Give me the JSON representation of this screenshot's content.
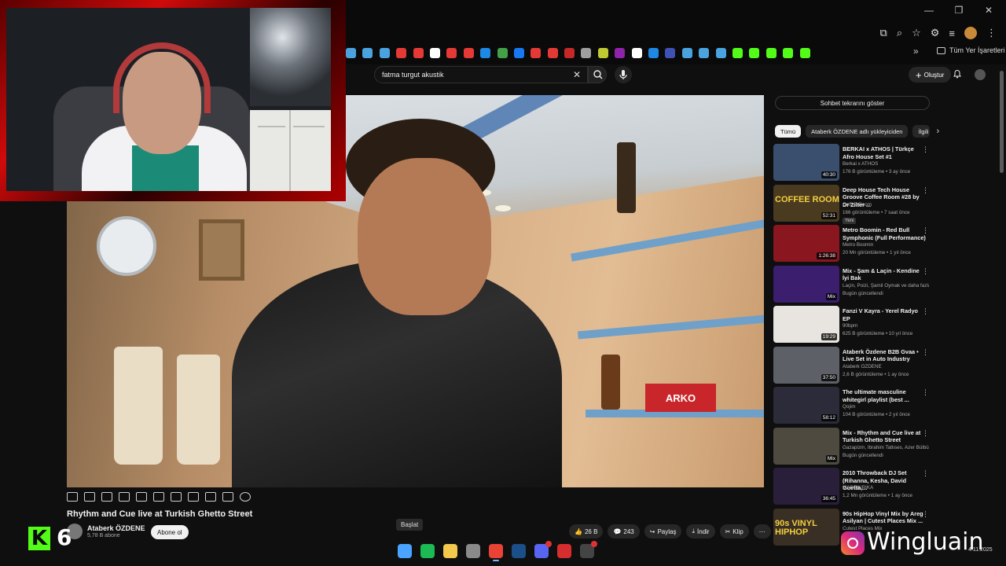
{
  "browser": {
    "bookmarks_folder": "Tüm Yer İşaretleri",
    "bookmark_colors": [
      "#4aa3df",
      "#4aa3df",
      "#4aa3df",
      "#e53935",
      "#e53935",
      "#ffffff",
      "#e53935",
      "#e53935",
      "#1e88e5",
      "#43a047",
      "#1877f2",
      "#e53935",
      "#e53935",
      "#c62828",
      "#9e9e9e",
      "#c0ca33",
      "#8e24aa",
      "#ffffff",
      "#1e88e5",
      "#3f51b5",
      "#4aa3df",
      "#4aa3df",
      "#4aa3df",
      "#53fc18",
      "#53fc18",
      "#53fc18",
      "#53fc18",
      "#53fc18"
    ]
  },
  "youtube": {
    "search": {
      "value": "fatma turgut akustik"
    },
    "create_label": "Oluştur"
  },
  "video": {
    "title": "Rhythm and Cue live at Turkish Ghetto Street",
    "scene_sign": "ARKO",
    "channel": {
      "name": "Ataberk ÖZDENE",
      "subs": "5,78 B abone"
    },
    "subscribe_label": "Abone ol",
    "actions": {
      "likes": "26 B",
      "dislikes": "243",
      "share": "Paylaş",
      "download": "İndir",
      "clip": "Klip"
    }
  },
  "tooltip": "Başlat",
  "sidebar": {
    "chat_label": "Sohbet tekrarını göster",
    "chips": [
      "Tümü",
      "Ataberk ÖZDENE adlı yükleyiciden",
      "İlgili"
    ],
    "recs": [
      {
        "title": "BERKAI x ATHOS | Türkçe Afro House Set #1",
        "channel": "Berkai x ATHOS",
        "meta": "176 B görüntüleme • 3 ay önce",
        "duration": "40:30",
        "color": "#3a4f6e",
        "badge": ""
      },
      {
        "title": "Deep House Tech House Groove Coffee Room #28 by Dr Zilter ...",
        "channel": "Coffee Room",
        "meta": "166 görüntüleme • 7 saat önce",
        "duration": "52:31",
        "color": "#4a3a20",
        "badge": "Yeni",
        "thumb_text": "COFFEE ROOM"
      },
      {
        "title": "Metro Boomin - Red Bull Symphonic (Full Performance)",
        "channel": "Metro Boomin",
        "meta": "20 Mn görüntüleme • 1 yıl önce",
        "duration": "1:26:38",
        "color": "#8a1620",
        "badge": ""
      },
      {
        "title": "Mix - Şam & Laçin - Kendine İyi Bak",
        "channel": "Laçin, Poizi, Şamil Oymak ve daha fazlası",
        "meta": "Bugün güncellendi",
        "duration": "Mix",
        "color": "#3b1e6e",
        "badge": ""
      },
      {
        "title": "Fanzi V Kayra - Yerel Radyo EP",
        "channel": "90bpm",
        "meta": "625 B görüntüleme • 10 yıl önce",
        "duration": "19:29",
        "color": "#e8e4e0",
        "badge": ""
      },
      {
        "title": "Ataberk Özdene B2B Gvaa • Live Set in Auto Industry",
        "channel": "Ataberk ÖZDENE",
        "meta": "2,6 B görüntüleme • 1 ay önce",
        "duration": "37:50",
        "color": "#5d6066",
        "badge": ""
      },
      {
        "title": "The ultimate masculine whitegirl playlist (best ...",
        "channel": "Qojim",
        "meta": "104 B görüntüleme • 2 yıl önce",
        "duration": "58:12",
        "color": "#2b2b3a",
        "badge": ""
      },
      {
        "title": "Mix - Rhythm and Cue live at Turkish Ghetto Street",
        "channel": "Gazapizm, İbrahim Tatlıses, Azer Bülbül v...",
        "meta": "Bugün güncellendi",
        "duration": "Mix",
        "color": "#4e4a40",
        "badge": ""
      },
      {
        "title": "2010 Throwback DJ Set (Rihanna, Kesha, David Guetta,...",
        "channel": "MADEINRIKA",
        "meta": "1,2 Mn görüntüleme • 1 ay önce",
        "duration": "36:45",
        "color": "#2a1f3a",
        "badge": ""
      },
      {
        "title": "90s HipHop Vinyl Mix by Areg Asilyan | Cutest Places Mix ...",
        "channel": "Cutest Places Mix",
        "meta": "",
        "duration": "",
        "color": "#3a2f24",
        "badge": "",
        "thumb_text": "90s VINYL HIPHOP"
      }
    ]
  },
  "overlay": {
    "kick_count": "6",
    "kick_letter": "K",
    "instagram": "Wingluain"
  },
  "system": {
    "date": "4.11.2025"
  },
  "taskbar": [
    {
      "name": "windows-start-icon",
      "color": "#4aa3ff"
    },
    {
      "name": "spotify-icon",
      "color": "#1db954"
    },
    {
      "name": "file-explorer-icon",
      "color": "#f2c94c"
    },
    {
      "name": "settings-icon",
      "color": "#8a8a8a"
    },
    {
      "name": "chrome-icon",
      "color": "#ea4335",
      "active": true
    },
    {
      "name": "steam-icon",
      "color": "#1b4f8a"
    },
    {
      "name": "discord-icon",
      "color": "#5865f2",
      "badge": true
    },
    {
      "name": "valorant-icon",
      "color": "#d62e2e"
    },
    {
      "name": "obs-icon",
      "color": "#444444",
      "badge": true
    }
  ]
}
